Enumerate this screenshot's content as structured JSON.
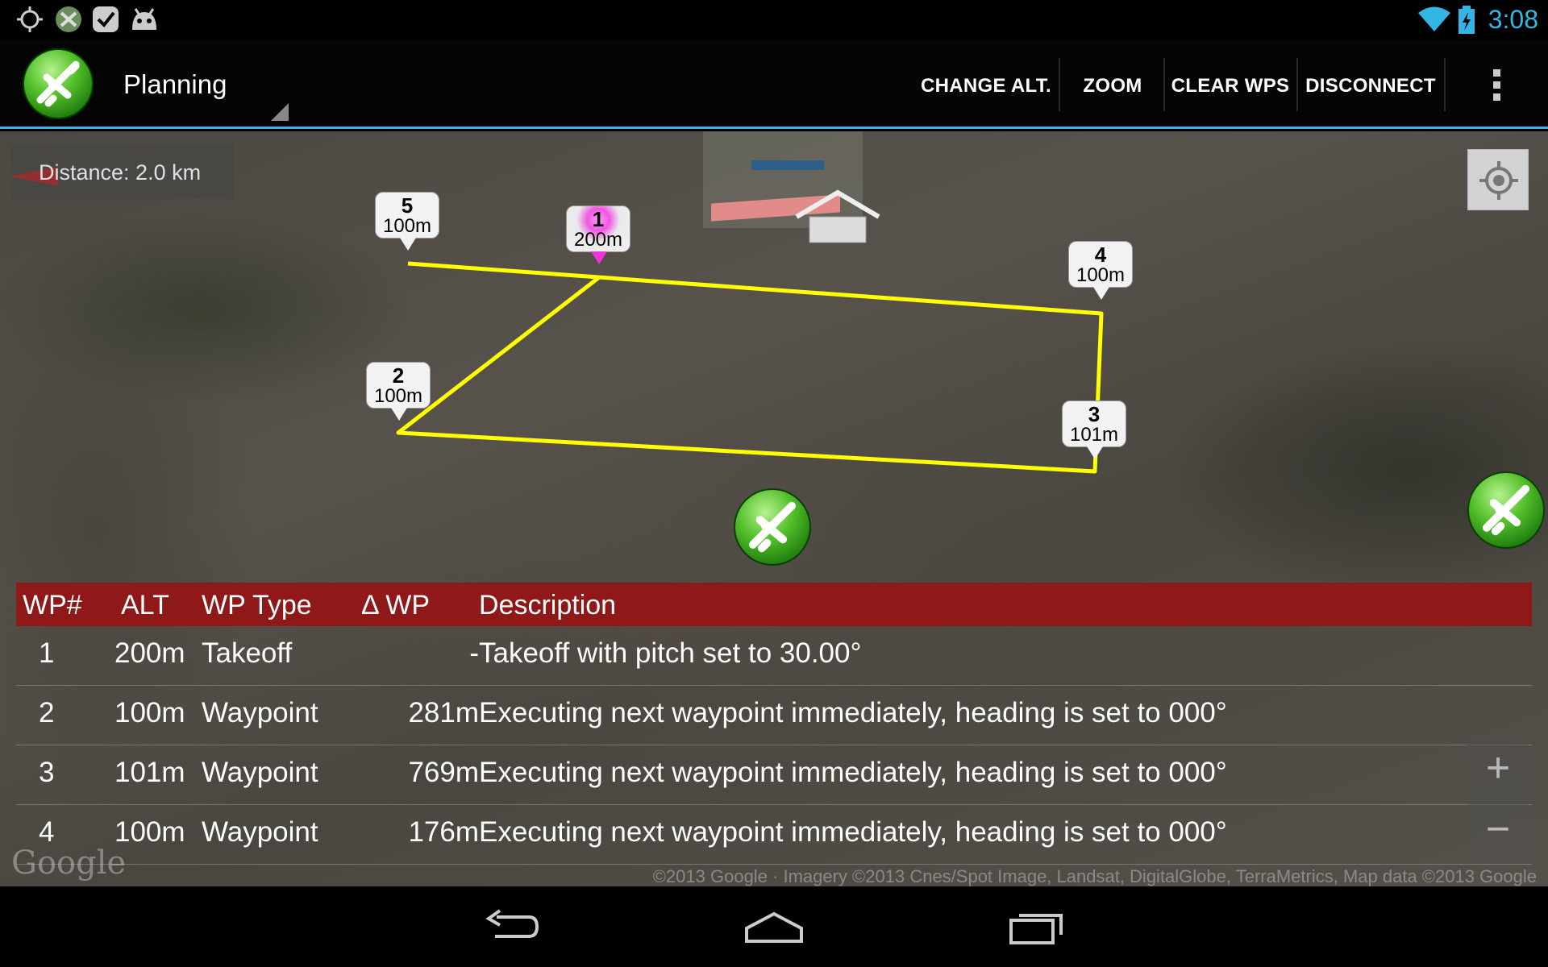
{
  "status_bar": {
    "time": "3:08",
    "icons": [
      "crosshair-icon",
      "app-icon",
      "check-icon",
      "android-icon"
    ],
    "right_icons": [
      "wifi-icon",
      "battery-charging-icon"
    ]
  },
  "action_bar": {
    "nav_title": "Planning",
    "buttons": {
      "change_alt": "CHANGE ALT.",
      "zoom": "ZOOM",
      "clear_wps": "CLEAR WPS",
      "disconnect": "DISCONNECT"
    },
    "accent_color": "#33b5e5"
  },
  "map": {
    "distance_label": "Distance: 2.0 km",
    "route_color": "#ffff00",
    "markers": [
      {
        "number": "1",
        "alt": "200m",
        "color": "pink"
      },
      {
        "number": "2",
        "alt": "100m",
        "color": "white"
      },
      {
        "number": "3",
        "alt": "101m",
        "color": "white"
      },
      {
        "number": "4",
        "alt": "100m",
        "color": "white"
      },
      {
        "number": "5",
        "alt": "100m",
        "color": "white"
      }
    ],
    "google_logo": "Google",
    "attribution": "©2013 Google · Imagery ©2013 Cnes/Spot Image, Landsat, DigitalGlobe, TerraMetrics, Map data ©2013 Google",
    "zoom_in": "+",
    "zoom_out": "−"
  },
  "waypoint_table": {
    "header_color": "#961414",
    "columns": [
      "WP#",
      "ALT",
      "WP Type",
      "Δ WP",
      "Description"
    ],
    "rows": [
      {
        "wp": "1",
        "alt": "200m",
        "type": "Takeoff",
        "delta": "-",
        "description": "Takeoff with pitch set to 30.00°"
      },
      {
        "wp": "2",
        "alt": "100m",
        "type": "Waypoint",
        "delta": "281m",
        "description": "Executing next waypoint immediately, heading is set to 000°"
      },
      {
        "wp": "3",
        "alt": "101m",
        "type": "Waypoint",
        "delta": "769m",
        "description": "Executing next waypoint immediately, heading is set to 000°"
      },
      {
        "wp": "4",
        "alt": "100m",
        "type": "Waypoint",
        "delta": "176m",
        "description": "Executing next waypoint immediately, heading is set to 000°"
      }
    ]
  },
  "navigation_bar": {
    "keys": [
      "back-icon",
      "home-icon",
      "recent-apps-icon"
    ]
  }
}
